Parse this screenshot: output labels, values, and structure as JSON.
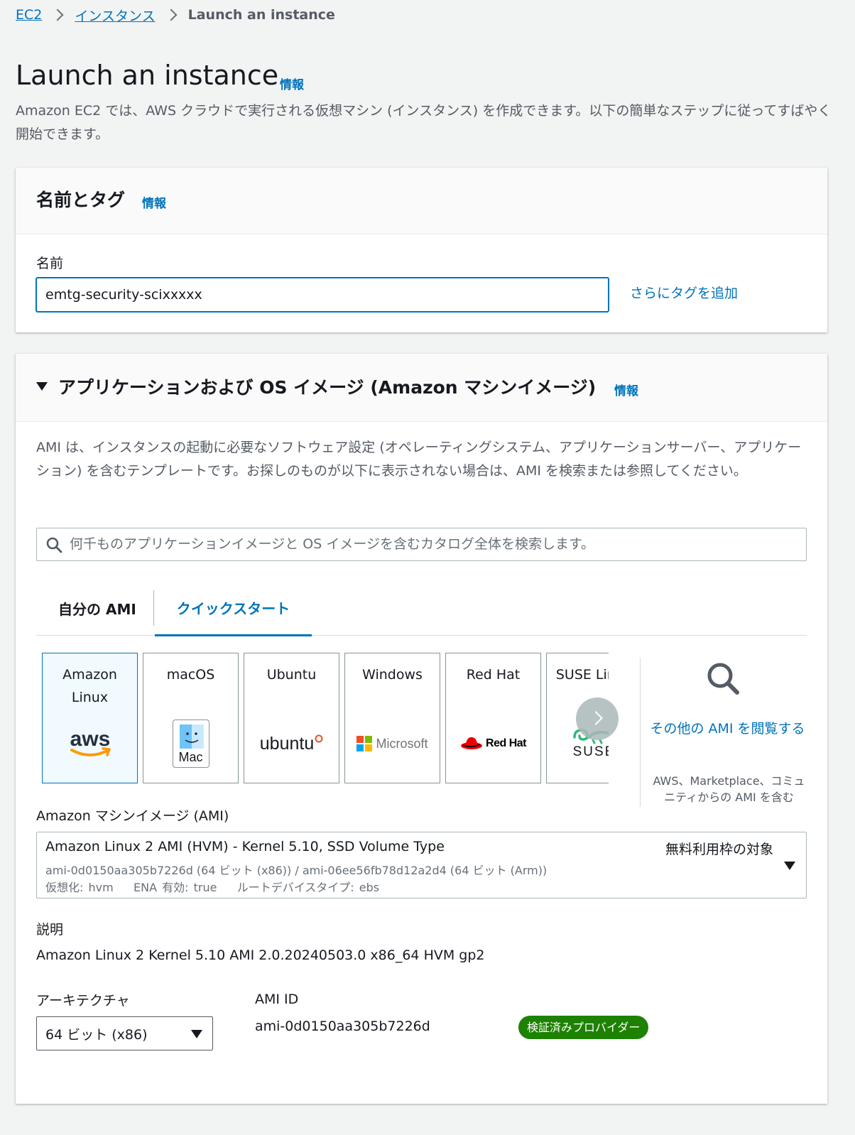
{
  "breadcrumb": {
    "items": [
      "EC2",
      "インスタンス"
    ],
    "current": "Launch an instance"
  },
  "page": {
    "title": "Launch an instance",
    "info_label": "情報",
    "description": "Amazon EC2 では、AWS クラウドで実行される仮想マシン (インスタンス) を作成できます。以下の簡単なステップに従ってすばやく開始できます。"
  },
  "name_tags": {
    "title": "名前とタグ",
    "info_label": "情報",
    "name_label": "名前",
    "name_value": "emtg-security-scixxxxx",
    "add_tags_link": "さらにタグを追加"
  },
  "ami_section": {
    "title": "アプリケーションおよび OS イメージ (Amazon マシンイメージ)",
    "info_label": "情報",
    "description": "AMI は、インスタンスの起動に必要なソフトウェア設定 (オペレーティングシステム、アプリケーションサーバー、アプリケーション) を含むテンプレートです。お探しのものが以下に表示されない場合は、AMI を検索または参照してください。",
    "search_placeholder": "何千ものアプリケーションイメージと OS イメージを含むカタログ全体を検索します。",
    "tabs": [
      {
        "label": "自分の AMI",
        "selected": false
      },
      {
        "label": "クイックスタート",
        "selected": true
      }
    ],
    "os_options": [
      {
        "name": "Amazon Linux",
        "logo": "aws-logo",
        "selected": true
      },
      {
        "name": "macOS",
        "logo": "mac-logo",
        "logo_text": "Mac",
        "selected": false
      },
      {
        "name": "Ubuntu",
        "logo": "ubuntu-logo",
        "logo_text": "ubuntu",
        "selected": false
      },
      {
        "name": "Windows",
        "logo": "microsoft-logo",
        "logo_text": "Microsoft",
        "selected": false
      },
      {
        "name": "Red Hat",
        "logo": "redhat-logo",
        "logo_text": "Red Hat",
        "selected": false
      },
      {
        "name": "SUSE Linux",
        "logo": "suse-logo",
        "logo_text": "SUSE",
        "selected": false
      }
    ],
    "browse_link": "その他の AMI を閲覧する",
    "browse_desc": "AWS、Marketplace、コミュニティからの AMI を含む",
    "ami_label": "Amazon マシンイメージ (AMI)",
    "ami_selected": {
      "name": "Amazon Linux 2 AMI (HVM) - Kernel 5.10, SSD Volume Type",
      "free_tier": "無料利用枠の対象",
      "ids": "ami-0d0150aa305b7226d (64 ビット (x86)) / ami-06ee56fb78d12a2d4 (64 ビット (Arm))",
      "meta": "仮想化: hvm    ENA 有効: true    ルートデバイスタイプ: ebs"
    },
    "desc_label": "説明",
    "desc_value": "Amazon Linux 2 Kernel 5.10 AMI 2.0.20240503.0 x86_64 HVM gp2",
    "arch_label": "アーキテクチャ",
    "arch_value": "64 ビット (x86)",
    "ami_id_label": "AMI ID",
    "ami_id_value": "ami-0d0150aa305b7226d",
    "verified_badge": "検証済みプロバイダー"
  },
  "colors": {
    "link": "#0073bb",
    "badge_green": "#1d8102",
    "selected_card_bg": "#f1faff"
  }
}
